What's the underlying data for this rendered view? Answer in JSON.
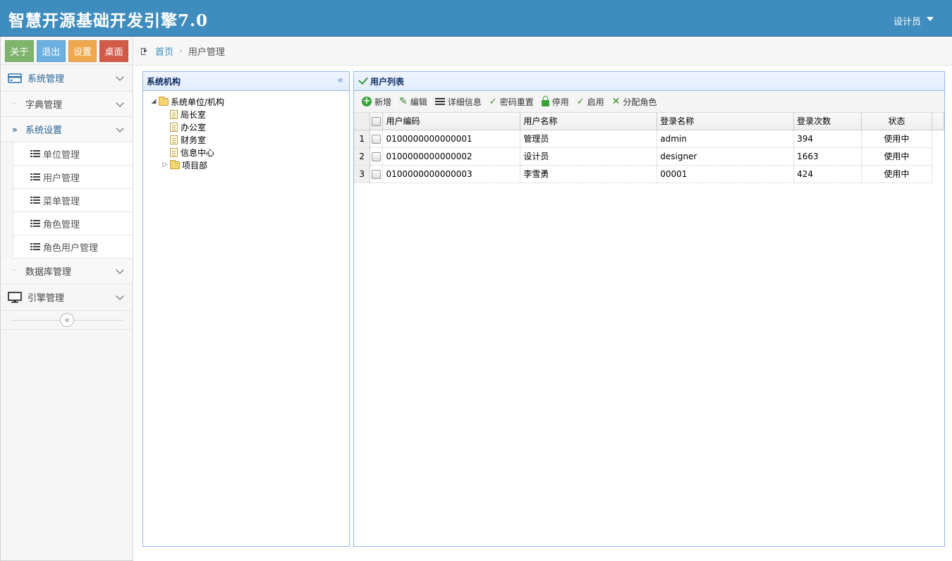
{
  "app": {
    "title": "智慧开源基础开发引擎7.0",
    "user": "设计员"
  },
  "quick_buttons": [
    {
      "label": "关于",
      "color": "#7fb46c"
    },
    {
      "label": "退出",
      "color": "#6bb0de"
    },
    {
      "label": "设置",
      "color": "#f0a84f"
    },
    {
      "label": "桌面",
      "color": "#d35a49"
    }
  ],
  "sidebar": {
    "system_management": "系统管理",
    "dictionary": "字典管理",
    "system_settings": "系统设置",
    "leaves": [
      "单位管理",
      "用户管理",
      "菜单管理",
      "角色管理",
      "角色用户管理"
    ],
    "database": "数据库管理",
    "engine": "引擎管理"
  },
  "breadcrumb": {
    "home": "首页",
    "current": "用户管理"
  },
  "org_panel": {
    "title": "系统机构",
    "root": "系统单位/机构",
    "children": [
      "局长室",
      "办公室",
      "财务室",
      "信息中心"
    ],
    "folder": "项目部"
  },
  "user_panel": {
    "title": "用户列表",
    "toolbar": [
      "新增",
      "编辑",
      "详细信息",
      "密码重置",
      "停用",
      "启用",
      "分配角色"
    ],
    "columns": [
      "用户编码",
      "用户名称",
      "登录名称",
      "登录次数",
      "状态"
    ],
    "rows": [
      {
        "n": "1",
        "code": "0100000000000001",
        "name": "管理员",
        "login": "admin",
        "count": "394",
        "status": "使用中"
      },
      {
        "n": "2",
        "code": "0100000000000002",
        "name": "设计员",
        "login": "designer",
        "count": "1663",
        "status": "使用中"
      },
      {
        "n": "3",
        "code": "0100000000000003",
        "name": "李雪勇",
        "login": "00001",
        "count": "424",
        "status": "使用中"
      }
    ]
  }
}
